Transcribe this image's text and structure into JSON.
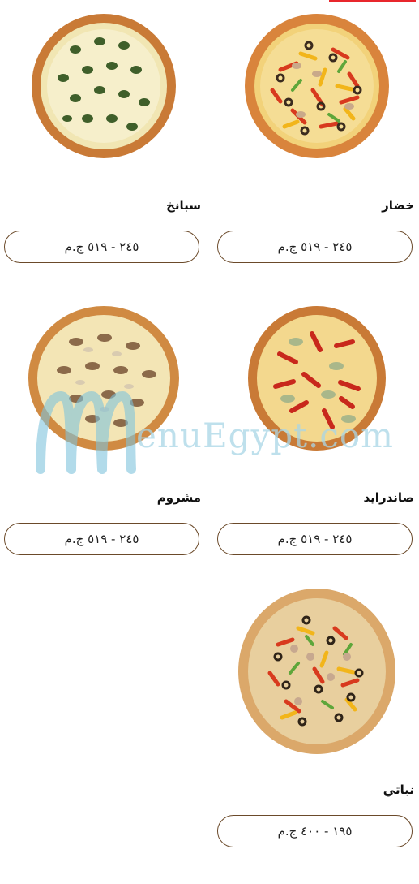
{
  "colors": {
    "accent": "#e8262c",
    "border": "#6b4a2a",
    "watermark": "#7fc3dc"
  },
  "menu": {
    "items": [
      {
        "name": "خضار",
        "price": "٢٤٥ - ٥١٩ ج.م"
      },
      {
        "name": "سبانخ",
        "price": "٢٤٥ - ٥١٩ ج.م"
      },
      {
        "name": "صاندرايد",
        "price": "٢٤٥ - ٥١٩ ج.م"
      },
      {
        "name": "مشروم",
        "price": "٢٤٥ - ٥١٩ ج.م"
      },
      {
        "name": "نباتي",
        "price": "١٩٥ - ٤٠٠ ج.م"
      }
    ]
  },
  "watermark": {
    "text": "enuEgypt.com"
  }
}
